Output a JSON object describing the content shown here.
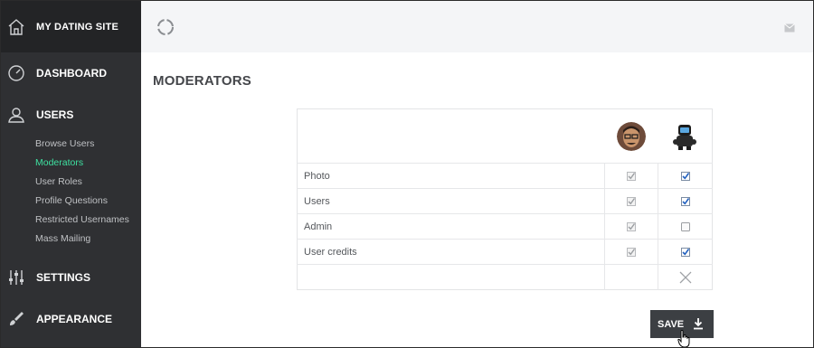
{
  "brand": {
    "name": "MY DATING SITE"
  },
  "nav": {
    "dashboard": "DASHBOARD",
    "users": "USERS",
    "users_sub": [
      "Browse Users",
      "Moderators",
      "User Roles",
      "Profile Questions",
      "Restricted Usernames",
      "Mass Mailing"
    ],
    "active_sub": "Moderators",
    "settings": "SETTINGS",
    "appearance": "APPEARANCE"
  },
  "icons": {
    "home": "home-icon",
    "dashboard": "dashboard-gauge-icon",
    "users": "user-icon",
    "settings": "sliders-icon",
    "appearance": "brush-icon",
    "refresh": "spinner-icon",
    "mail": "envelope-icon",
    "save": "download-icon"
  },
  "page": {
    "title": "MODERATORS"
  },
  "moderators": [
    {
      "avatar": "man-with-glasses",
      "permissions": {
        "Photo": true,
        "Users": true,
        "Admin": true,
        "User credits": true
      },
      "editable": false
    },
    {
      "avatar": "robot",
      "permissions": {
        "Photo": true,
        "Users": true,
        "Admin": false,
        "User credits": true
      },
      "editable": true
    }
  ],
  "rows": [
    {
      "label": "Photo",
      "mod1": true,
      "mod2": true
    },
    {
      "label": "Users",
      "mod1": true,
      "mod2": true
    },
    {
      "label": "Admin",
      "mod1": true,
      "mod2": false
    },
    {
      "label": "User credits",
      "mod1": true,
      "mod2": true
    }
  ],
  "actions": {
    "save_label": "SAVE"
  },
  "colors": {
    "sidebar": "#2f3033",
    "brand_bar": "#232426",
    "active_link": "#3ee0a0",
    "button": "#3c3f43",
    "checkbox_blue": "#1f5fbf"
  }
}
